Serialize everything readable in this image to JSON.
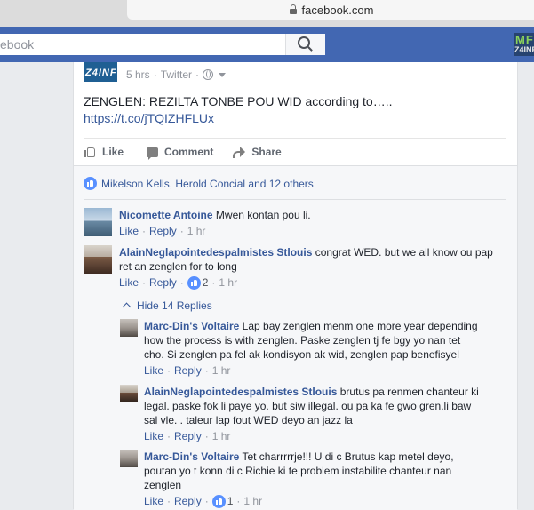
{
  "browser": {
    "url": "facebook.com"
  },
  "header": {
    "search_placeholder": "ebook",
    "brand_line1": "MF",
    "brand_line2": "Z4INF"
  },
  "post": {
    "thumb_text": "Z4INF",
    "time": "5 hrs",
    "source": "Twitter",
    "text": "ZENGLEN: REZILTA TONBE POU WID according to…..",
    "link": "https://t.co/jTQIZHFLUx",
    "actions": {
      "like": "Like",
      "comment": "Comment",
      "share": "Share"
    },
    "reactions_text": "Mikelson Kells, Herold Concial and 12 others"
  },
  "comments": [
    {
      "name": "Nicomette Antoine",
      "text": "Mwen kontan pou li.",
      "like": "Like",
      "reply": "Reply",
      "time": "1 hr"
    },
    {
      "name": "AlainNeglapointedespalmistes Stlouis",
      "text": "congrat WED. but we all know ou pap ret an zenglen for to long",
      "like": "Like",
      "reply": "Reply",
      "likes": "2",
      "time": "1 hr",
      "hide_replies": "Hide 14 Replies"
    }
  ],
  "replies": [
    {
      "name": "Marc-Din's Voltaire",
      "text": "Lap bay zenglen menm one more year depending how the process is with zenglen. Paske zenglen tj fe bgy yo nan tet cho. Si zenglen pa fel ak kondisyon ak wid, zenglen pap benefisyel",
      "like": "Like",
      "reply": "Reply",
      "time": "1 hr"
    },
    {
      "name": "AlainNeglapointedespalmistes Stlouis",
      "text": "brutus pa renmen chanteur ki legal. paske fok li paye yo. but siw illegal. ou pa ka fe gwo gren.li baw sal vle. . taleur lap fout WED deyo an jazz la",
      "like": "Like",
      "reply": "Reply",
      "time": "1 hr"
    },
    {
      "name": "Marc-Din's Voltaire",
      "text": "Tet charrrrrje!!! U di c Brutus kap metel deyo, poutan yo t konn di c Richie ki te problem instabilite chanteur nan zenglen",
      "like": "Like",
      "reply": "Reply",
      "likes": "1",
      "time": "1 hr"
    }
  ],
  "colors": {
    "fb_blue": "#4267b2",
    "link": "#365899",
    "muted": "#90949c",
    "like_blue": "#5890ff"
  }
}
